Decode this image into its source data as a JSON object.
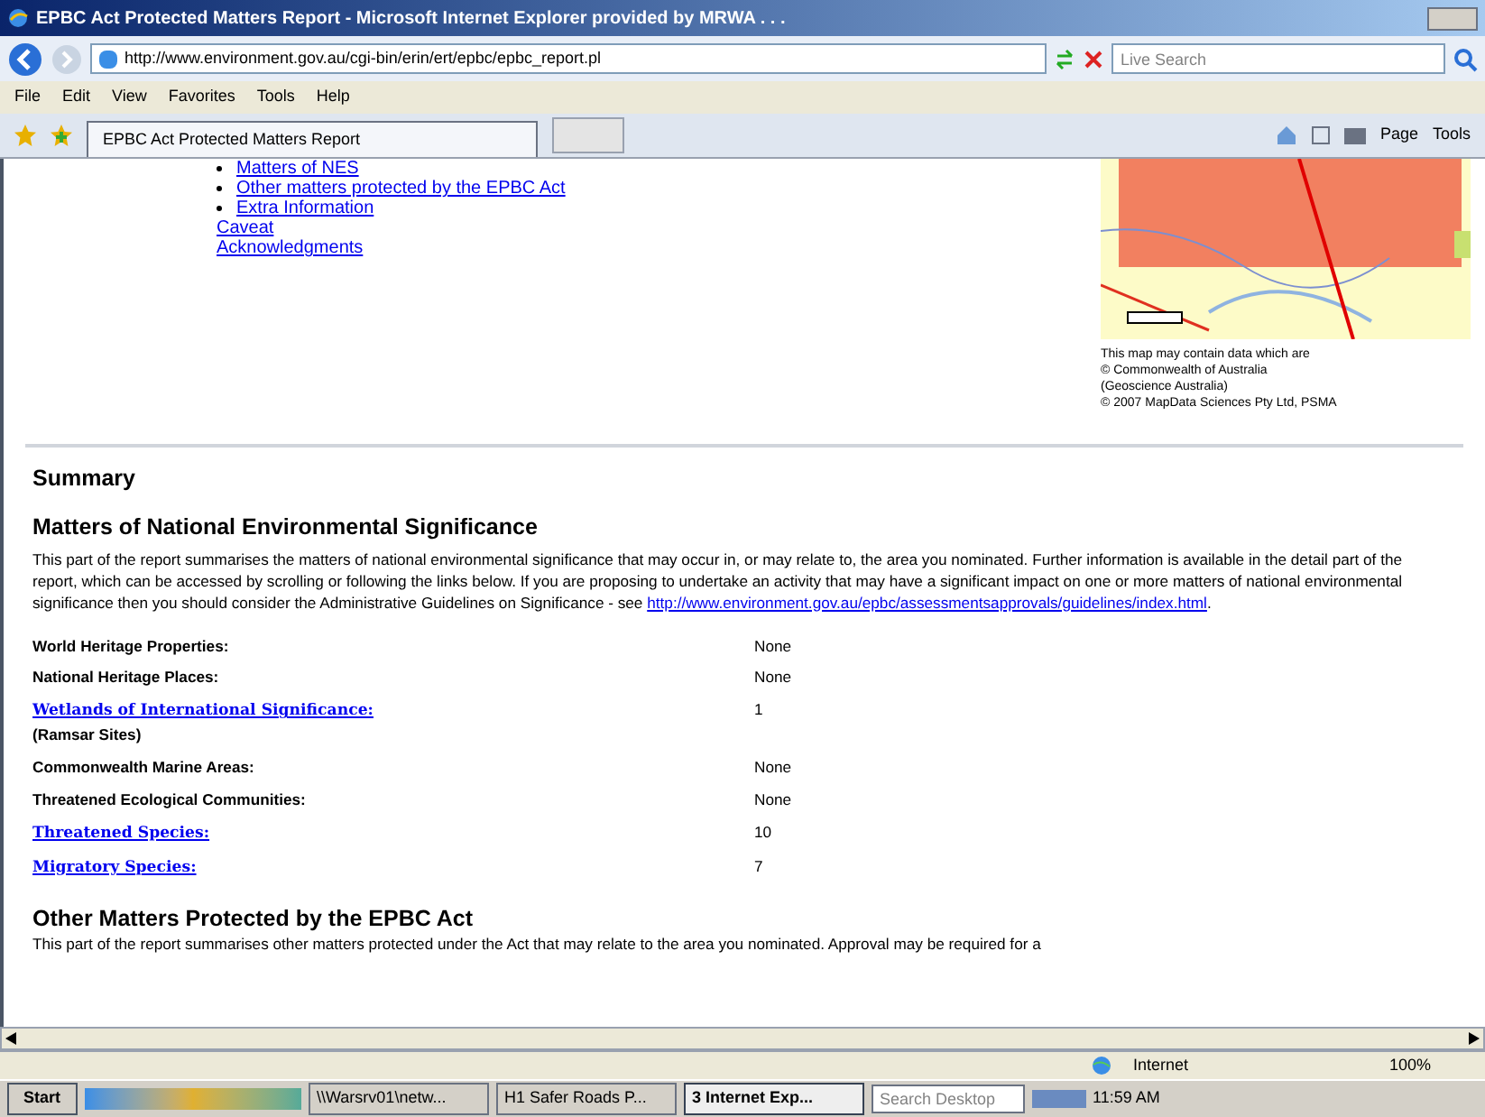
{
  "window": {
    "title": "EPBC Act Protected Matters Report - Microsoft Internet Explorer provided by MRWA . . ."
  },
  "address_bar": {
    "url": "http://www.environment.gov.au/cgi-bin/erin/ert/epbc/epbc_report.pl",
    "search_placeholder": "Live Search"
  },
  "menu": [
    "File",
    "Edit",
    "View",
    "Favorites",
    "Tools",
    "Help"
  ],
  "tabs": [
    {
      "label": "EPBC Act Protected Matters Report",
      "selected": true
    }
  ],
  "command_bar": [
    "Page",
    "Tools"
  ],
  "contents": {
    "bullets": [
      "Matters of NES",
      "Other matters protected by the EPBC Act",
      "Extra Information"
    ],
    "links": [
      "Caveat",
      "Acknowledgments"
    ]
  },
  "map": {
    "caption": [
      "This map may contain data which are",
      "© Commonwealth of Australia",
      "(Geoscience Australia)",
      "© 2007 MapData Sciences Pty Ltd, PSMA"
    ]
  },
  "summary": {
    "title": "Summary",
    "section_title": "Matters of National Environmental Significance",
    "intro": "This part of the report summarises the matters of national environmental significance that may occur in, or may relate to, the area you nominated. Further information is available in the detail part of the report, which can be accessed by scrolling or following the links below. If you are proposing to undertake an activity that may have a significant impact on one or more matters of national environmental significance then you should consider the Administrative Guidelines on Significance - see ",
    "intro_link": "http://www.environment.gov.au/epbc/assessmentsapprovals/guidelines/index.html",
    "intro_end": ".",
    "rows": [
      {
        "label": "World Heritage Properties:",
        "link": false,
        "value": "None"
      },
      {
        "label": "National Heritage Places:",
        "link": false,
        "value": "None"
      },
      {
        "label": "Wetlands of International Significance:",
        "link": true,
        "sub": "(Ramsar Sites)",
        "value": "1"
      },
      {
        "label": "Commonwealth Marine Areas:",
        "link": false,
        "value": "None"
      },
      {
        "label": "Threatened Ecological Communities:",
        "link": false,
        "value": "None"
      },
      {
        "label": "Threatened Species:",
        "link": true,
        "value": "10"
      },
      {
        "label": "Migratory Species:",
        "link": true,
        "value": "7"
      }
    ]
  },
  "other": {
    "title": "Other Matters Protected by the EPBC Act",
    "intro": "This part of the report summarises other matters protected under the Act that may relate to the area you nominated. Approval may be required for a"
  },
  "status_bar": {
    "zone": "Internet",
    "zoom": "100%"
  },
  "taskbar": {
    "start": "Start",
    "windows": [
      {
        "label": "\\\\Warsrv01\\netw...",
        "selected": false
      },
      {
        "label": "H1 Safer Roads P...",
        "selected": false
      },
      {
        "label": "3 Internet Exp...",
        "selected": true
      }
    ],
    "search_placeholder": "Search Desktop",
    "time": "11:59 AM"
  }
}
